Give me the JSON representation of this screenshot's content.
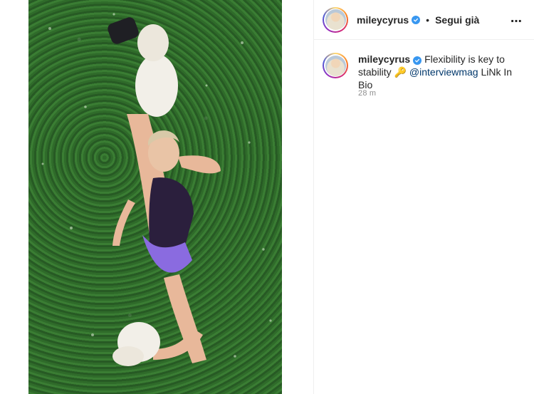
{
  "post": {
    "image_alt": "Woman doing a standing split lying on green grass wearing a purple bodysuit and white furry boots",
    "colors": {
      "grass": "#336f2e",
      "bodysuit": "#2b1f3d",
      "briefs": "#8a6be0",
      "boots": "#f2efe8"
    }
  },
  "header": {
    "username": "mileycyrus",
    "separator": "•",
    "follow_label": "Segui già",
    "more_icon": "⋯"
  },
  "caption": {
    "username": "mileycyrus",
    "text_part1": "Flexibility is key to stability",
    "key_emoji": "🔑",
    "mention": "@interviewmag",
    "text_part2": "LiNk In Bio",
    "time": "28 m"
  }
}
